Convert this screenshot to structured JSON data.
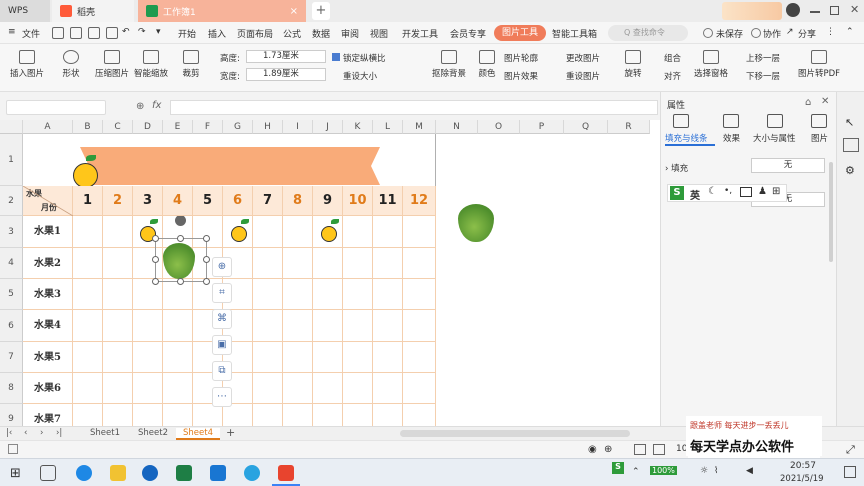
{
  "tabs": {
    "wps": "WPS",
    "daoke": "稻壳",
    "workbook": "工作簿1",
    "close": "×",
    "add": "+"
  },
  "menu": {
    "file": "文件",
    "items": [
      "开始",
      "插入",
      "页面布局",
      "公式",
      "数据",
      "审阅",
      "视图",
      "开发工具",
      "会员专享"
    ],
    "picture_tool": "图片工具",
    "smart_toolbox": "智能工具箱",
    "search": "Q 查找命令",
    "unsaved": "未保存",
    "collab": "协作",
    "share": "分享"
  },
  "ribbon": {
    "insert_picture": "插入图片",
    "shape": "形状",
    "compress": "压缩图片",
    "smart_scale": "智能缩放",
    "crop": "裁剪",
    "height_label": "高度:",
    "height_value": "1.73厘米",
    "width_label": "宽度:",
    "width_value": "1.89厘米",
    "lock_ratio": "锁定纵横比",
    "reset_size": "重设大小",
    "remove_bg": "抠除背景",
    "color": "颜色",
    "picture_outline": "图片轮廓",
    "picture_effect": "图片效果",
    "change_picture": "更改图片",
    "reset_picture": "重设图片",
    "rotate": "旋转",
    "group": "组合",
    "align": "对齐",
    "selection_pane": "选择窗格",
    "bring_forward": "上移一层",
    "send_backward": "下移一层",
    "pic_to_pdf": "图片转PDF"
  },
  "formula": {
    "fx": "fx"
  },
  "columns": [
    "A",
    "B",
    "C",
    "D",
    "E",
    "F",
    "G",
    "H",
    "I",
    "J",
    "K",
    "L",
    "M",
    "N",
    "O",
    "P",
    "Q",
    "R"
  ],
  "rows": [
    "1",
    "2",
    "3",
    "4",
    "5",
    "6",
    "7",
    "8",
    "9"
  ],
  "table": {
    "corner_top": "水果",
    "corner_bottom": "月份",
    "months": [
      "1",
      "2",
      "3",
      "4",
      "5",
      "6",
      "7",
      "8",
      "9",
      "10",
      "11",
      "12"
    ],
    "month_colors": [
      "#222222",
      "#e07b1a"
    ],
    "fruits": [
      "水果1",
      "水果2",
      "水果3",
      "水果4",
      "水果5",
      "水果6",
      "水果7"
    ],
    "banner_color": "#f9ab79"
  },
  "pane": {
    "title": "属性",
    "tabs": [
      "填充与线条",
      "效果",
      "大小与属性",
      "图片"
    ],
    "fill_label": "填充",
    "fill_value": "无",
    "line_value": "无"
  },
  "ime": {
    "s_logo": "S",
    "label": "英"
  },
  "sheets": [
    "Sheet1",
    "Sheet2",
    "Sheet4"
  ],
  "status": {
    "zoom": "10"
  },
  "watermark": {
    "line1": "跟盖老师  每天进步一丢丢儿",
    "line2": "每天学点办公软件"
  },
  "taskbar": {
    "time": "20:57",
    "date": "2021/5/19",
    "battery": "100%"
  }
}
